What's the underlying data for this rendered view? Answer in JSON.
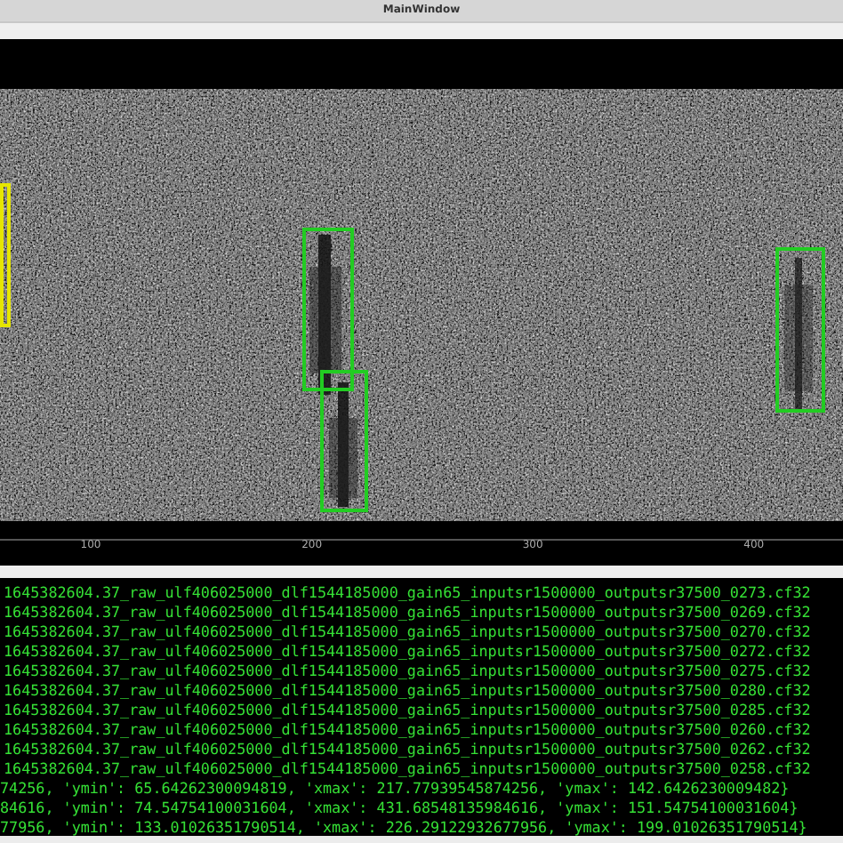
{
  "window": {
    "title": "MainWindow"
  },
  "spectrogram": {
    "detections": [
      {
        "color": "#e6e600"
      },
      {
        "color": "#22cc22"
      },
      {
        "color": "#22cc22"
      },
      {
        "color": "#22cc22"
      }
    ]
  },
  "x_axis": {
    "ticks": [
      "100",
      "200",
      "300",
      "400"
    ]
  },
  "terminal": {
    "lines": [
      "1645382604.37_raw_ulf406025000_dlf1544185000_gain65_inputsr1500000_outputsr37500_0273.cf32",
      "1645382604.37_raw_ulf406025000_dlf1544185000_gain65_inputsr1500000_outputsr37500_0269.cf32",
      "1645382604.37_raw_ulf406025000_dlf1544185000_gain65_inputsr1500000_outputsr37500_0270.cf32",
      "1645382604.37_raw_ulf406025000_dlf1544185000_gain65_inputsr1500000_outputsr37500_0272.cf32",
      "1645382604.37_raw_ulf406025000_dlf1544185000_gain65_inputsr1500000_outputsr37500_0275.cf32",
      "1645382604.37_raw_ulf406025000_dlf1544185000_gain65_inputsr1500000_outputsr37500_0280.cf32",
      "1645382604.37_raw_ulf406025000_dlf1544185000_gain65_inputsr1500000_outputsr37500_0285.cf32",
      "1645382604.37_raw_ulf406025000_dlf1544185000_gain65_inputsr1500000_outputsr37500_0260.cf32",
      "1645382604.37_raw_ulf406025000_dlf1544185000_gain65_inputsr1500000_outputsr37500_0262.cf32",
      "1645382604.37_raw_ulf406025000_dlf1544185000_gain65_inputsr1500000_outputsr37500_0258.cf32",
      "74256, 'ymin': 65.64262300094819, 'xmax': 217.77939545874256, 'ymax': 142.6426230009482}",
      "84616, 'ymin': 74.54754100031604, 'xmax': 431.68548135984616, 'ymax': 151.54754100031604}",
      "77956, 'ymin': 133.01026351790514, 'xmax': 226.29122932677956, 'ymax': 199.01026351790514}"
    ]
  }
}
